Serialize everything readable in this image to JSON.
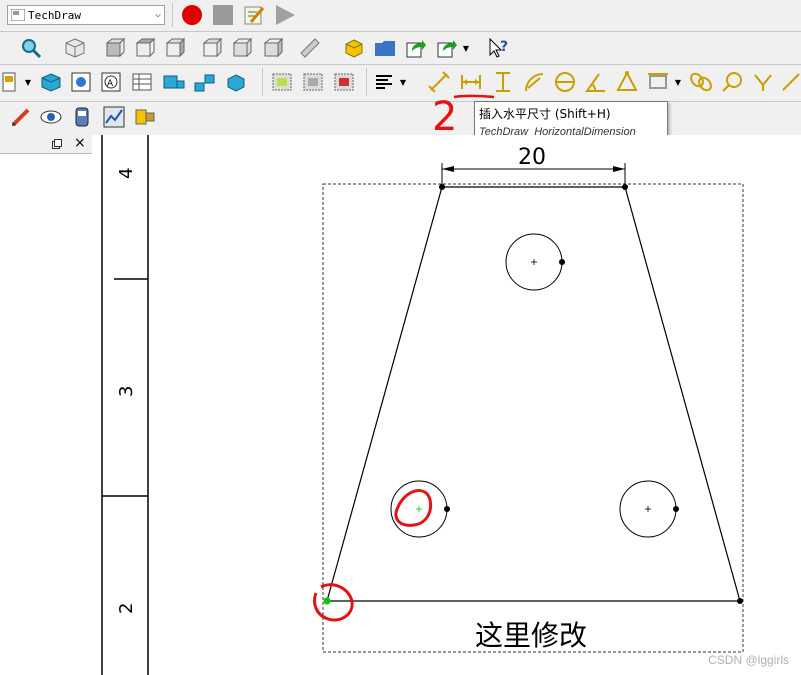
{
  "workbench": {
    "selected": "TechDraw"
  },
  "tooltip": {
    "title": "插入水平尺寸 (Shift+H)",
    "command": "TechDraw_HorizontalDimension"
  },
  "ruler": {
    "labels": [
      "4",
      "3",
      "2"
    ]
  },
  "drawing": {
    "dimension_value": "20",
    "note": "这里修改"
  },
  "annotations": {
    "step_number": "2"
  },
  "watermark": "CSDN @lggirls",
  "panel": {
    "close": "×"
  },
  "colors": {
    "accent_red": "#e81111",
    "selected_point": "#00cc00",
    "record": "#e00000"
  }
}
